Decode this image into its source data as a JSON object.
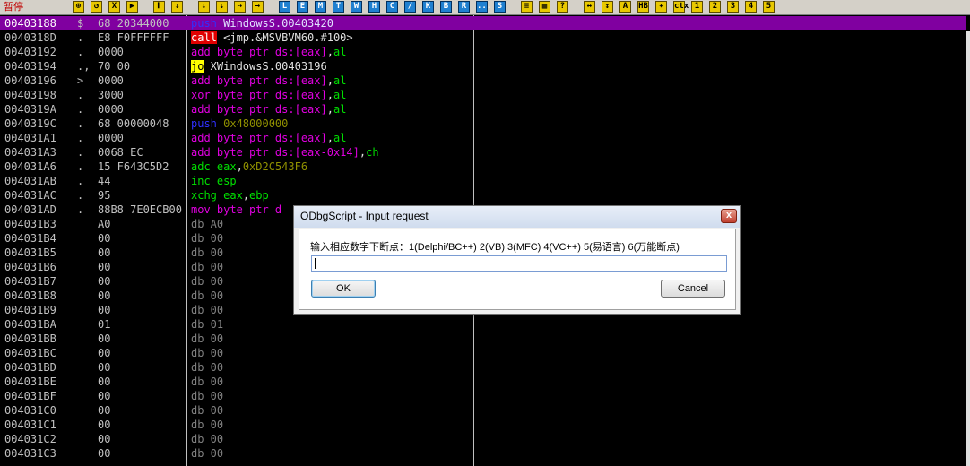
{
  "toolbar": {
    "status": "暂停",
    "buttons": [
      "⊕",
      "↺",
      "X",
      "▶",
      "Ⅱ",
      "↴",
      "↓",
      "⇣",
      "⇢",
      "→",
      "L",
      "E",
      "M",
      "T",
      "W",
      "H",
      "C",
      "/",
      "K",
      "B",
      "R",
      "...",
      "S",
      "≡",
      "▦",
      "?",
      "↔",
      "↕",
      "A",
      "HB",
      "✦",
      "ctx",
      "1",
      "2",
      "3",
      "4",
      "5"
    ]
  },
  "rows": [
    {
      "addr": "00403188",
      "mark": "$",
      "hex": "68 20344000",
      "mn": "push",
      "mclass": "m-push",
      "args": [
        {
          "t": " WindowsS.00403420",
          "c": "arg"
        }
      ],
      "sel": true
    },
    {
      "addr": "0040318D",
      "mark": ".",
      "hex": "E8 F0FFFFFF",
      "mn": "call",
      "mclass": "m-call",
      "args": [
        {
          "t": " <jmp.&MSVBVM60.#100>",
          "c": "arg"
        }
      ]
    },
    {
      "addr": "00403192",
      "mark": ".",
      "hex": "0000",
      "mn": "add",
      "mclass": "m-add",
      "args": [
        {
          "t": " byte ptr ds:[eax]",
          "c": "m-add"
        },
        {
          "t": ",",
          "c": "arg"
        },
        {
          "t": "al",
          "c": "arg-reg"
        }
      ]
    },
    {
      "addr": "00403194",
      "mark": ".,",
      "hex": "70 00",
      "mn": "jo",
      "mclass": "m-jo",
      "args": [
        {
          "t": " XWindowsS.00403196",
          "c": "arg"
        }
      ]
    },
    {
      "addr": "00403196",
      "mark": ">",
      "hex": "0000",
      "mn": "add",
      "mclass": "m-add",
      "args": [
        {
          "t": " byte ptr ds:[eax]",
          "c": "m-add"
        },
        {
          "t": ",",
          "c": "arg"
        },
        {
          "t": "al",
          "c": "arg-reg"
        }
      ]
    },
    {
      "addr": "00403198",
      "mark": ".",
      "hex": "3000",
      "mn": "xor",
      "mclass": "m-xor",
      "args": [
        {
          "t": " byte ptr ds:[eax]",
          "c": "m-add"
        },
        {
          "t": ",",
          "c": "arg"
        },
        {
          "t": "al",
          "c": "arg-reg"
        }
      ]
    },
    {
      "addr": "0040319A",
      "mark": ".",
      "hex": "0000",
      "mn": "add",
      "mclass": "m-add",
      "args": [
        {
          "t": " byte ptr ds:[eax]",
          "c": "m-add"
        },
        {
          "t": ",",
          "c": "arg"
        },
        {
          "t": "al",
          "c": "arg-reg"
        }
      ]
    },
    {
      "addr": "0040319C",
      "mark": ".",
      "hex": "68 00000048",
      "mn": "push",
      "mclass": "m-push",
      "args": [
        {
          "t": " 0x48000000",
          "c": "arg-olive"
        }
      ]
    },
    {
      "addr": "004031A1",
      "mark": ".",
      "hex": "0000",
      "mn": "add",
      "mclass": "m-add",
      "args": [
        {
          "t": " byte ptr ds:[eax]",
          "c": "m-add"
        },
        {
          "t": ",",
          "c": "arg"
        },
        {
          "t": "al",
          "c": "arg-reg"
        }
      ]
    },
    {
      "addr": "004031A3",
      "mark": ".",
      "hex": "0068 EC",
      "mn": "add",
      "mclass": "m-add",
      "args": [
        {
          "t": " byte ptr ds:[eax-0x14]",
          "c": "m-add"
        },
        {
          "t": ",",
          "c": "arg"
        },
        {
          "t": "ch",
          "c": "arg-reg"
        }
      ]
    },
    {
      "addr": "004031A6",
      "mark": ".",
      "hex": "15 F643C5D2",
      "mn": "adc",
      "mclass": "m-adc",
      "args": [
        {
          "t": " eax",
          "c": "arg-reg"
        },
        {
          "t": ",",
          "c": "arg"
        },
        {
          "t": "0xD2C543F6",
          "c": "arg-olive"
        }
      ]
    },
    {
      "addr": "004031AB",
      "mark": ".",
      "hex": "44",
      "mn": "inc",
      "mclass": "m-inc",
      "args": [
        {
          "t": " esp",
          "c": "arg-reg"
        }
      ]
    },
    {
      "addr": "004031AC",
      "mark": ".",
      "hex": "95",
      "mn": "xchg",
      "mclass": "m-xchg",
      "args": [
        {
          "t": " eax",
          "c": "arg-reg"
        },
        {
          "t": ",",
          "c": "arg"
        },
        {
          "t": "ebp",
          "c": "arg-reg"
        }
      ]
    },
    {
      "addr": "004031AD",
      "mark": ".",
      "hex": "88B8 7E0ECB00",
      "mn": "mov",
      "mclass": "m-mov",
      "args": [
        {
          "t": " byte ptr d",
          "c": "m-add"
        }
      ]
    },
    {
      "addr": "004031B3",
      "mark": "",
      "hex": "A0",
      "mn": "db",
      "mclass": "m-db",
      "args": [
        {
          "t": " A0",
          "c": "m-db"
        }
      ]
    },
    {
      "addr": "004031B4",
      "mark": "",
      "hex": "00",
      "mn": "db",
      "mclass": "m-db",
      "args": [
        {
          "t": " 00",
          "c": "m-db"
        }
      ]
    },
    {
      "addr": "004031B5",
      "mark": "",
      "hex": "00",
      "mn": "db",
      "mclass": "m-db",
      "args": [
        {
          "t": " 00",
          "c": "m-db"
        }
      ]
    },
    {
      "addr": "004031B6",
      "mark": "",
      "hex": "00",
      "mn": "db",
      "mclass": "m-db",
      "args": [
        {
          "t": " 00",
          "c": "m-db"
        }
      ]
    },
    {
      "addr": "004031B7",
      "mark": "",
      "hex": "00",
      "mn": "db",
      "mclass": "m-db",
      "args": [
        {
          "t": " 00",
          "c": "m-db"
        }
      ]
    },
    {
      "addr": "004031B8",
      "mark": "",
      "hex": "00",
      "mn": "db",
      "mclass": "m-db",
      "args": [
        {
          "t": " 00",
          "c": "m-db"
        }
      ]
    },
    {
      "addr": "004031B9",
      "mark": "",
      "hex": "00",
      "mn": "db",
      "mclass": "m-db",
      "args": [
        {
          "t": " 00",
          "c": "m-db"
        }
      ]
    },
    {
      "addr": "004031BA",
      "mark": "",
      "hex": "01",
      "mn": "db",
      "mclass": "m-db",
      "args": [
        {
          "t": " 01",
          "c": "m-db"
        }
      ]
    },
    {
      "addr": "004031BB",
      "mark": "",
      "hex": "00",
      "mn": "db",
      "mclass": "m-db",
      "args": [
        {
          "t": " 00",
          "c": "m-db"
        }
      ]
    },
    {
      "addr": "004031BC",
      "mark": "",
      "hex": "00",
      "mn": "db",
      "mclass": "m-db",
      "args": [
        {
          "t": " 00",
          "c": "m-db"
        }
      ]
    },
    {
      "addr": "004031BD",
      "mark": "",
      "hex": "00",
      "mn": "db",
      "mclass": "m-db",
      "args": [
        {
          "t": " 00",
          "c": "m-db"
        }
      ]
    },
    {
      "addr": "004031BE",
      "mark": "",
      "hex": "00",
      "mn": "db",
      "mclass": "m-db",
      "args": [
        {
          "t": " 00",
          "c": "m-db"
        }
      ]
    },
    {
      "addr": "004031BF",
      "mark": "",
      "hex": "00",
      "mn": "db",
      "mclass": "m-db",
      "args": [
        {
          "t": " 00",
          "c": "m-db"
        }
      ]
    },
    {
      "addr": "004031C0",
      "mark": "",
      "hex": "00",
      "mn": "db",
      "mclass": "m-db",
      "args": [
        {
          "t": " 00",
          "c": "m-db"
        }
      ]
    },
    {
      "addr": "004031C1",
      "mark": "",
      "hex": "00",
      "mn": "db",
      "mclass": "m-db",
      "args": [
        {
          "t": " 00",
          "c": "m-db"
        }
      ]
    },
    {
      "addr": "004031C2",
      "mark": "",
      "hex": "00",
      "mn": "db",
      "mclass": "m-db",
      "args": [
        {
          "t": " 00",
          "c": "m-db"
        }
      ]
    },
    {
      "addr": "004031C3",
      "mark": "",
      "hex": "00",
      "mn": "db",
      "mclass": "m-db",
      "args": [
        {
          "t": " 00",
          "c": "m-db"
        }
      ]
    }
  ],
  "dialog": {
    "title": "ODbgScript - Input request",
    "close_label": "x",
    "prompt": "输入相应数字下断点：1(Delphi/BC++)  2(VB)  3(MFC) 4(VC++) 5(易语言)  6(万能断点)",
    "input_value": "",
    "ok_label": "OK",
    "cancel_label": "Cancel"
  },
  "colors": {
    "selection": "#8000a0",
    "background": "#000000"
  }
}
